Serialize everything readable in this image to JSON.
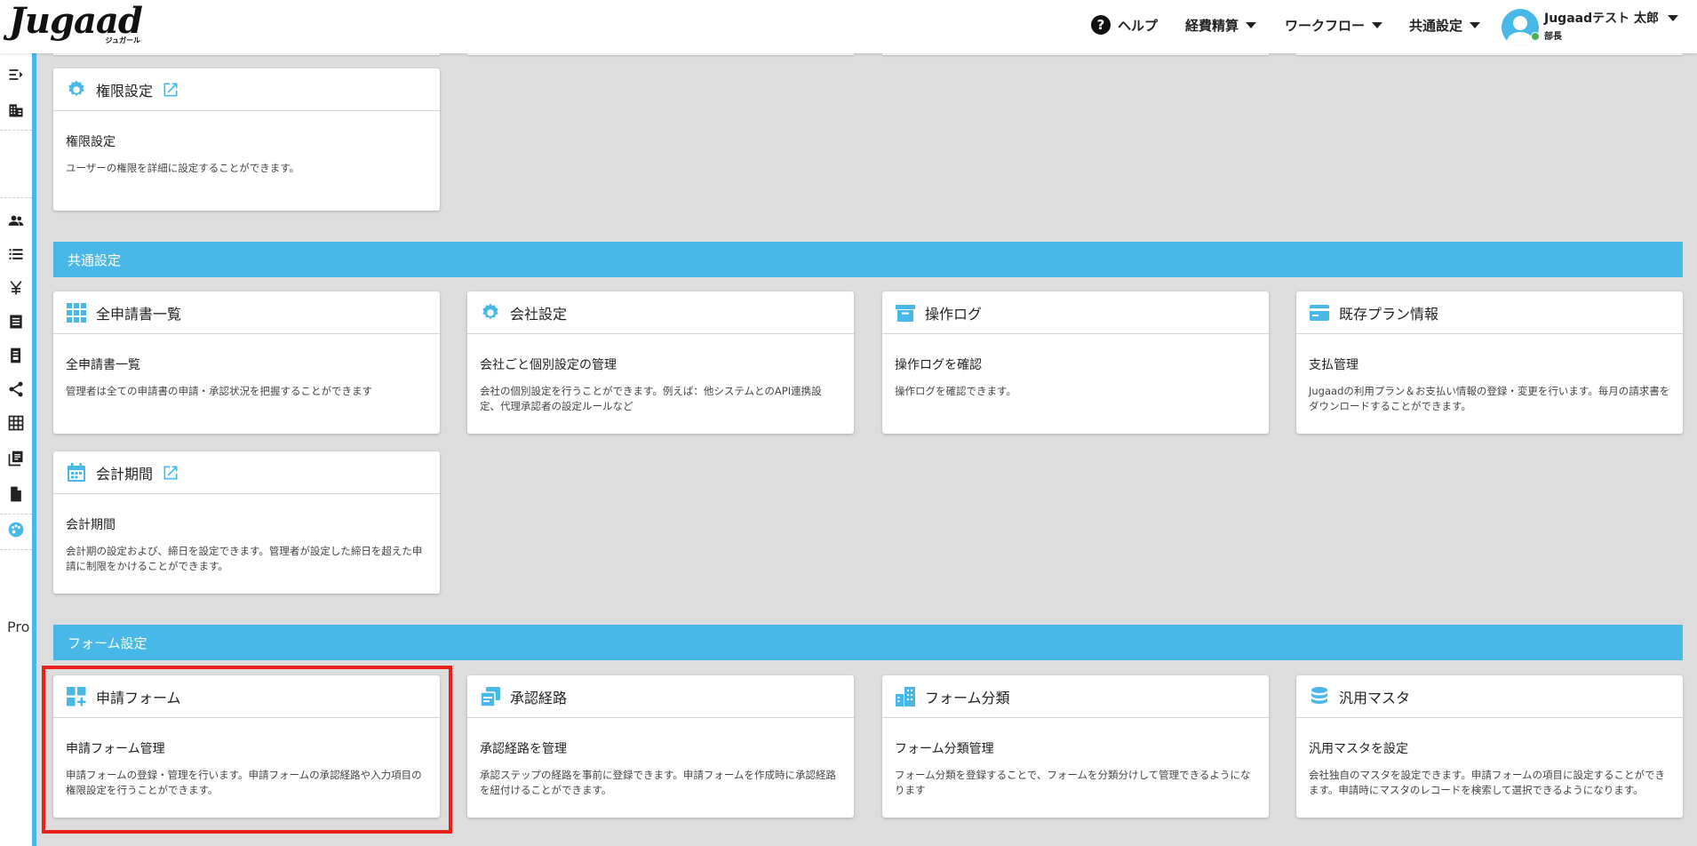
{
  "header": {
    "logo": "Jugaad",
    "logo_sub": "ジュガール",
    "help": "ヘルプ",
    "nav_items": [
      "経費精算",
      "ワークフロー",
      "共通設定"
    ],
    "user_name": "Jugaadテスト 太郎",
    "user_role": "部長"
  },
  "sidebar": {
    "icons": [
      "expand-menu-icon",
      "building-icon",
      "users-icon",
      "list-icon",
      "yen-icon",
      "receipt-icon",
      "ledger-icon",
      "share-icon",
      "grid-table-icon",
      "library-icon",
      "document-icon",
      "palette-icon"
    ],
    "text": "Pro"
  },
  "sections": {
    "common": "共通設定",
    "form": "フォーム設定"
  },
  "cards": {
    "permission": {
      "title": "権限設定",
      "sub": "権限設定",
      "desc": "ユーザーの権限を詳細に設定することができます。",
      "icon": "gear-icon"
    },
    "all_applications": {
      "title": "全申請書一覧",
      "sub": "全申請書一覧",
      "desc": "管理者は全ての申請書の申請・承認状況を把握することができます",
      "icon": "apps-grid-icon"
    },
    "company": {
      "title": "会社設定",
      "sub": "会社ごと個別設定の管理",
      "desc": "会社の個別設定を行うことができます。例えば：他システムとのAPI連携設定、代理承認者の設定ルールなど",
      "icon": "gear-icon"
    },
    "operation_log": {
      "title": "操作ログ",
      "sub": "操作ログを確認",
      "desc": "操作ログを確認できます。",
      "icon": "archive-box-icon"
    },
    "plan": {
      "title": "既存プラン情報",
      "sub": "支払管理",
      "desc": "Jugaadの利用プラン＆お支払い情報の登録・変更を行います。毎月の請求書をダウンロードすることができます。",
      "icon": "credit-card-icon"
    },
    "fiscal_period": {
      "title": "会計期間",
      "sub": "会計期間",
      "desc": "会計期の設定および、締日を設定できます。管理者が設定した締日を超えた申請に制限をかけることができます。",
      "icon": "calendar-icon"
    },
    "application_form": {
      "title": "申請フォーム",
      "sub": "申請フォーム管理",
      "desc": "申請フォームの登録・管理を行います。申請フォームの承認経路や入力項目の権限設定を行うことができます。",
      "icon": "dashboard-add-icon"
    },
    "approval_route": {
      "title": "承認経路",
      "sub": "承認経路を管理",
      "desc": "承認ステップの経路を事前に登録できます。申請フォームを作成時に承認経路を紐付けることができます。",
      "icon": "route-docs-icon"
    },
    "form_category": {
      "title": "フォーム分類",
      "sub": "フォーム分類管理",
      "desc": "フォーム分類を登録することで、フォームを分類分けして管理できるようになります",
      "icon": "buildings-icon"
    },
    "general_master": {
      "title": "汎用マスタ",
      "sub": "汎用マスタを設定",
      "desc": "会社独自のマスタを設定できます。申請フォームの項目に設定することができます。申請時にマスタのレコードを検索して選択できるようになります。",
      "icon": "database-icon"
    }
  },
  "colors": {
    "accent": "#48b8e8",
    "highlight": "#e82218",
    "background": "#dddddd"
  }
}
